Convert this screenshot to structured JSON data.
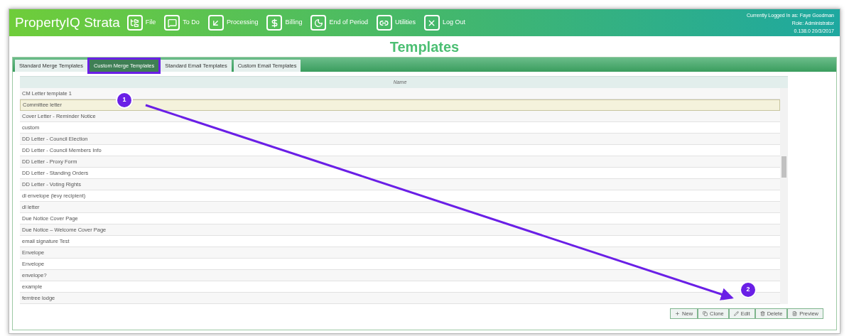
{
  "header": {
    "logo": "PropertyIQ Strata",
    "nav": [
      {
        "kind": "file",
        "label": "File"
      },
      {
        "kind": "todo",
        "label": "To Do"
      },
      {
        "kind": "processing",
        "label": "Processing"
      },
      {
        "kind": "billing",
        "label": "Billing"
      },
      {
        "kind": "period",
        "label": "End of Period"
      },
      {
        "kind": "utilities",
        "label": "Utilities"
      },
      {
        "kind": "logout",
        "label": "Log Out"
      }
    ],
    "user_info": [
      "Currently Logged In as: Faye Goodman",
      "Role: Administrator",
      "0.138.0 20/3/2017"
    ]
  },
  "page_title": "Templates",
  "tabs": [
    {
      "label": "Standard Merge Templates",
      "selected": false,
      "highlighted": false
    },
    {
      "label": "Custom Merge Templates",
      "selected": true,
      "highlighted": true
    },
    {
      "label": "Standard Email Templates",
      "selected": false,
      "highlighted": false
    },
    {
      "label": "Custom Email Templates",
      "selected": false,
      "highlighted": false
    }
  ],
  "table": {
    "columns": [
      "Name"
    ],
    "rows": [
      {
        "name": "CM Letter template 1",
        "selected": false
      },
      {
        "name": "Committee letter",
        "selected": true
      },
      {
        "name": "Cover Letter - Reminder Notice",
        "selected": false
      },
      {
        "name": "custom",
        "selected": false
      },
      {
        "name": "DD Letter - Council Election",
        "selected": false
      },
      {
        "name": "DD Letter - Council Members Info",
        "selected": false
      },
      {
        "name": "DD Letter - Proxy Form",
        "selected": false
      },
      {
        "name": "DD Letter - Standing Orders",
        "selected": false
      },
      {
        "name": "DD Letter - Voting Rights",
        "selected": false
      },
      {
        "name": "dl envelope (levy recipient)",
        "selected": false
      },
      {
        "name": "dl letter",
        "selected": false
      },
      {
        "name": "Due Notice Cover Page",
        "selected": false
      },
      {
        "name": "Due Notice – Welcome Cover Page",
        "selected": false
      },
      {
        "name": "email signature Test",
        "selected": false
      },
      {
        "name": "Envelope",
        "selected": false
      },
      {
        "name": "Envelope",
        "selected": false
      },
      {
        "name": "envelope?",
        "selected": false
      },
      {
        "name": "example",
        "selected": false
      },
      {
        "name": "ferntree lodge",
        "selected": false
      }
    ]
  },
  "buttons": [
    {
      "kind": "new",
      "label": "New"
    },
    {
      "kind": "clone",
      "label": "Clone"
    },
    {
      "kind": "edit",
      "label": "Edit"
    },
    {
      "kind": "delete",
      "label": "Delete"
    },
    {
      "kind": "preview",
      "label": "Preview"
    }
  ],
  "callouts": [
    {
      "label": "1"
    },
    {
      "label": "2"
    }
  ]
}
